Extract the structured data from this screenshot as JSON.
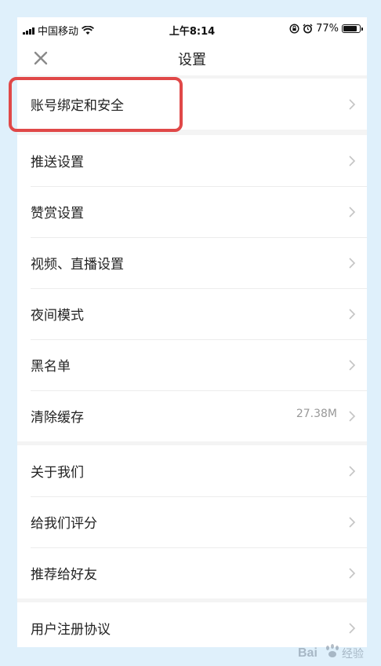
{
  "status_bar": {
    "carrier": "中国移动",
    "time": "上午8:14",
    "battery": "77%",
    "battery_level": 0.77
  },
  "header": {
    "title": "设置"
  },
  "groups": [
    {
      "items": [
        {
          "label": "账号绑定和安全"
        }
      ]
    },
    {
      "items": [
        {
          "label": "推送设置"
        },
        {
          "label": "赞赏设置"
        },
        {
          "label": "视频、直播设置"
        },
        {
          "label": "夜间模式"
        },
        {
          "label": "黑名单"
        },
        {
          "label": "清除缓存",
          "value": "27.38M"
        }
      ]
    },
    {
      "items": [
        {
          "label": "关于我们"
        },
        {
          "label": "给我们评分"
        },
        {
          "label": "推荐给好友"
        }
      ]
    },
    {
      "items": [
        {
          "label": "用户注册协议"
        }
      ]
    }
  ],
  "colors": {
    "highlight": "#e04848",
    "background": "#dff0fb"
  },
  "watermark_text": "Bai 经验"
}
